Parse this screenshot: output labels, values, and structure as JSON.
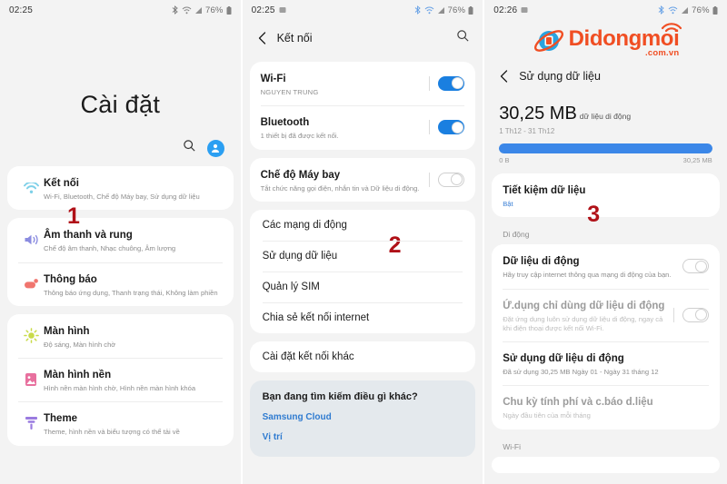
{
  "panel1": {
    "statusbar": {
      "time": "02:25",
      "battery": "76%",
      "icons": [
        "bluetooth-icon",
        "wifi-icon",
        "signal-icon",
        "battery-icon"
      ]
    },
    "page_title": "Cài đặt",
    "toolbar": {
      "search_icon": "search-icon",
      "account_icon": "account-avatar-icon"
    },
    "marker": "1",
    "items": [
      {
        "icon": "wifi-icon",
        "color": "#7ed0e8",
        "title": "Kết nối",
        "sub": "Wi-Fi, Bluetooth, Chế độ Máy bay, Sử dụng dữ liệu"
      },
      {
        "icon": "sound-icon",
        "color": "#8b8ce0",
        "title": "Âm thanh và rung",
        "sub": "Chế độ âm thanh, Nhạc chuông, Âm lượng"
      },
      {
        "icon": "notification-icon",
        "color": "#f0756e",
        "title": "Thông báo",
        "sub": "Thông báo ứng dụng, Thanh trạng thái, Không làm phiền"
      },
      {
        "icon": "brightness-icon",
        "color": "#c9db4a",
        "title": "Màn hình",
        "sub": "Độ sáng, Màn hình chờ"
      },
      {
        "icon": "wallpaper-icon",
        "color": "#e8709e",
        "title": "Màn hình nền",
        "sub": "Hình nền màn hình chờ, Hình nền màn hình khóa"
      },
      {
        "icon": "theme-icon",
        "color": "#9a7be0",
        "title": "Theme",
        "sub": "Theme, hình nền và biểu tượng có thể tải về"
      }
    ]
  },
  "panel2": {
    "statusbar": {
      "time": "02:25",
      "battery": "76%"
    },
    "appbar": {
      "back_icon": "back-arrow-icon",
      "title": "Kết nối",
      "search_icon": "search-icon"
    },
    "marker": "2",
    "toggles": [
      {
        "title": "Wi-Fi",
        "sub": "NGUYEN TRUNG",
        "state": "on"
      },
      {
        "title": "Bluetooth",
        "sub": "1 thiết bị đã được kết nối.",
        "state": "on"
      }
    ],
    "airplane": {
      "title": "Chế độ Máy bay",
      "sub": "Tắt chức năng gọi điện, nhắn tin và Dữ liệu di động.",
      "state": "off"
    },
    "menu": [
      "Các mạng di động",
      "Sử dụng dữ liệu",
      "Quản lý SIM",
      "Chia sẻ kết nối internet"
    ],
    "other": "Cài đặt kết nối khác",
    "info": {
      "question": "Bạn đang tìm kiếm điều gì khác?",
      "links": [
        "Samsung Cloud",
        "Vị trí"
      ]
    }
  },
  "panel3": {
    "statusbar": {
      "time": "02:26",
      "battery": "76%"
    },
    "logo": {
      "main": "Didongmoi",
      "sub": ".com.vn",
      "icon": "didongmoi-planet-icon",
      "wifi_icon": "wifi-arc-icon"
    },
    "appbar": {
      "back_icon": "back-arrow-icon",
      "title": "Sử dụng dữ liệu"
    },
    "marker": "3",
    "usage": {
      "amount": "30,25 MB",
      "unit_label": "dữ liệu di động",
      "range": "1 Th12 - 31 Th12",
      "bar_min": "0 B",
      "bar_max": "30,25 MB",
      "bar_percent": 100
    },
    "saver": {
      "title": "Tiết kiệm dữ liệu",
      "sub": "Bật"
    },
    "section_mobile": "Di động",
    "rows": [
      {
        "title": "Dữ liệu di động",
        "sub": "Hãy truy cập internet thông qua mạng di động của bạn.",
        "toggle": "off",
        "muted": false
      },
      {
        "title": "Ứ.dụng chỉ dùng dữ liệu di động",
        "sub": "Đặt ứng dụng luôn sử dụng dữ liệu di động, ngay cả khi điện thoại được kết nối Wi-Fi.",
        "toggle": "off",
        "muted": true
      },
      {
        "title": "Sử dụng dữ liệu di động",
        "sub": "Đã sử dụng 30,25 MB Ngày 01 - Ngày 31 tháng 12",
        "muted": false
      },
      {
        "title": "Chu kỳ tính phí và c.báo d.liệu",
        "sub": "Ngày đầu tiên của mỗi tháng",
        "sub_blue": true,
        "muted": true
      }
    ],
    "section_wifi": "Wi-Fi"
  }
}
